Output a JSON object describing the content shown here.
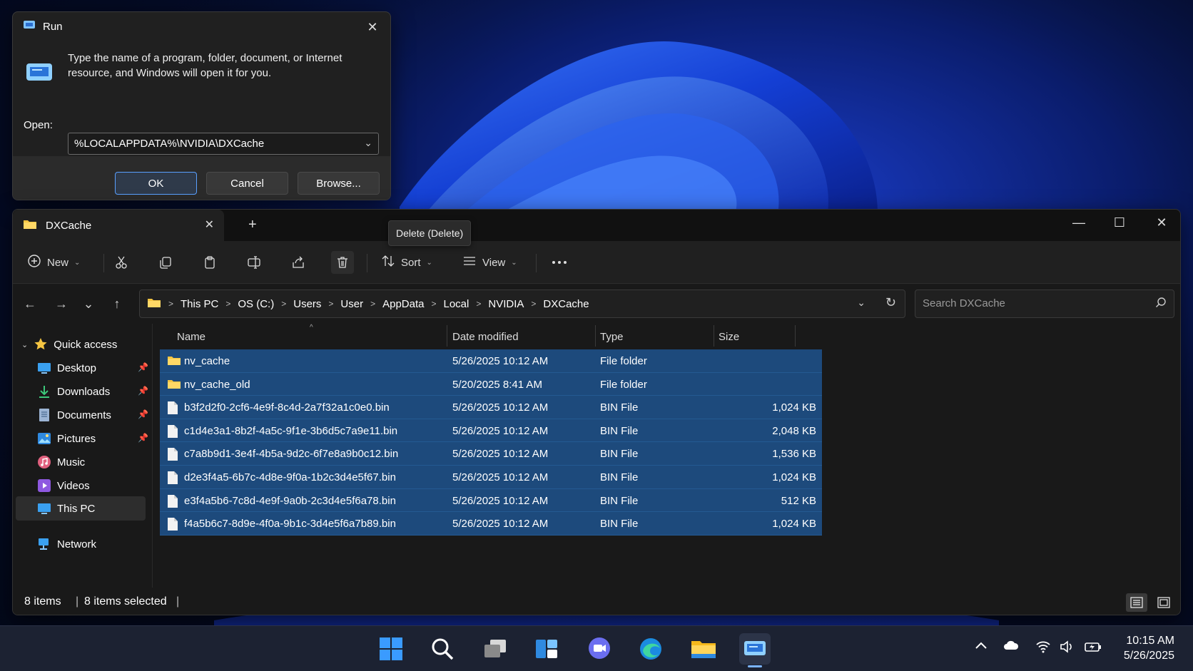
{
  "colors": {
    "selection": "#1d4a7c",
    "accent": "#5aa0ff",
    "folder": "#f5c542"
  },
  "run_dialog": {
    "title": "Run",
    "description": "Type the name of a program, folder, document, or Internet resource, and Windows will open it for you.",
    "open_label": "Open:",
    "open_value": "%LOCALAPPDATA%\\NVIDIA\\DXCache",
    "ok_label": "OK",
    "cancel_label": "Cancel",
    "browse_label": "Browse..."
  },
  "explorer": {
    "tab_title": "DXCache",
    "toolbar": {
      "new_label": "New",
      "sort_label": "Sort",
      "view_label": "View",
      "icons": [
        "cut-icon",
        "copy-icon",
        "paste-icon",
        "rename-icon",
        "share-icon",
        "delete-icon",
        "more-icon"
      ]
    },
    "tooltip": "Delete (Delete)",
    "breadcrumb": [
      "This PC",
      "OS (C:)",
      "Users",
      "User",
      "AppData",
      "Local",
      "NVIDIA",
      "DXCache"
    ],
    "search_placeholder": "Search DXCache",
    "sidebar": {
      "quick_access": "Quick access",
      "items": [
        {
          "label": "Desktop",
          "icon": "desktop-icon",
          "pinned": true
        },
        {
          "label": "Downloads",
          "icon": "downloads-icon",
          "pinned": true
        },
        {
          "label": "Documents",
          "icon": "documents-icon",
          "pinned": true
        },
        {
          "label": "Pictures",
          "icon": "pictures-icon",
          "pinned": true
        },
        {
          "label": "Music",
          "icon": "music-icon",
          "pinned": false
        },
        {
          "label": "Videos",
          "icon": "videos-icon",
          "pinned": false
        }
      ],
      "this_pc": "This PC",
      "network": "Network"
    },
    "columns": {
      "name": "Name",
      "date": "Date modified",
      "type": "Type",
      "size": "Size"
    },
    "files": [
      {
        "name": "nv_cache",
        "date": "5/26/2025 10:12 AM",
        "type": "File folder",
        "size": "",
        "kind": "folder"
      },
      {
        "name": "nv_cache_old",
        "date": "5/20/2025 8:41 AM",
        "type": "File folder",
        "size": "",
        "kind": "folder"
      },
      {
        "name": "b3f2d2f0-2cf6-4e9f-8c4d-2a7f32a1c0e0.bin",
        "date": "5/26/2025 10:12 AM",
        "type": "BIN File",
        "size": "1,024 KB",
        "kind": "file"
      },
      {
        "name": "c1d4e3a1-8b2f-4a5c-9f1e-3b6d5c7a9e11.bin",
        "date": "5/26/2025 10:12 AM",
        "type": "BIN File",
        "size": "2,048 KB",
        "kind": "file"
      },
      {
        "name": "c7a8b9d1-3e4f-4b5a-9d2c-6f7e8a9b0c12.bin",
        "date": "5/26/2025 10:12 AM",
        "type": "BIN File",
        "size": "1,536 KB",
        "kind": "file"
      },
      {
        "name": "d2e3f4a5-6b7c-4d8e-9f0a-1b2c3d4e5f67.bin",
        "date": "5/26/2025 10:12 AM",
        "type": "BIN File",
        "size": "1,024 KB",
        "kind": "file"
      },
      {
        "name": "e3f4a5b6-7c8d-4e9f-9a0b-2c3d4e5f6a78.bin",
        "date": "5/26/2025 10:12 AM",
        "type": "BIN File",
        "size": "512 KB",
        "kind": "file"
      },
      {
        "name": "f4a5b6c7-8d9e-4f0a-9b1c-3d4e5f6a7b89.bin",
        "date": "5/26/2025 10:12 AM",
        "type": "BIN File",
        "size": "1,024 KB",
        "kind": "file"
      }
    ],
    "status": {
      "items": "8 items",
      "selected": "8 items selected"
    }
  },
  "taskbar": {
    "apps": [
      "start-icon",
      "search-icon",
      "task-view-icon",
      "widgets-icon",
      "chat-icon",
      "edge-icon",
      "file-explorer-icon",
      "run-icon"
    ],
    "time": "10:15 AM",
    "date": "5/26/2025"
  }
}
